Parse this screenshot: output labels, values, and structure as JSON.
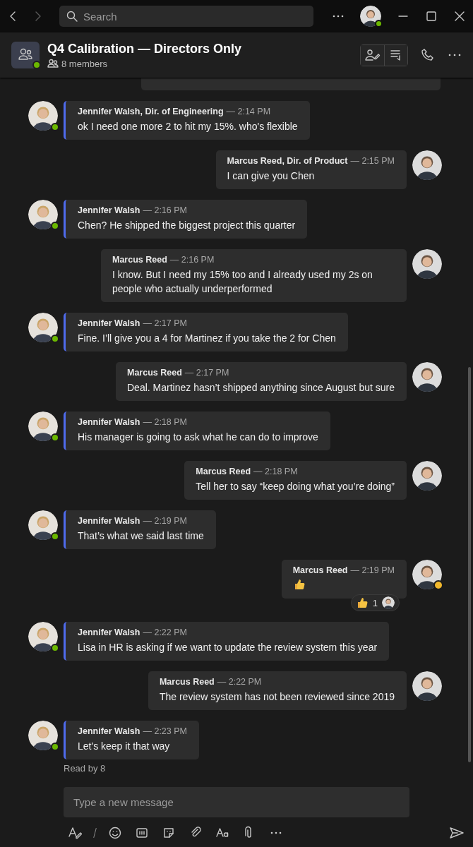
{
  "title_bar": {
    "nav": [
      {
        "kind": "back",
        "disabled": false
      },
      {
        "kind": "forward",
        "disabled": true
      }
    ],
    "search": {
      "placeholder": "Search"
    },
    "online": true
  },
  "chat_header": {
    "title": "Q4 Calibration — Directors Only",
    "members": "8 members",
    "online": true
  },
  "messages": [
    {
      "kind": "sent",
      "cut_off": true
    },
    {
      "kind": "received",
      "sender": "Jennifer Walsh, Dir. of Engineering",
      "time": "— 2:14 PM",
      "text": "ok I need one more 2 to hit my 15%. who's flexible",
      "online": true
    },
    {
      "kind": "sent",
      "sender": "Marcus Reed, Dir. of Product",
      "time": "— 2:15 PM",
      "text": "I can give you Chen"
    },
    {
      "kind": "received",
      "sender": "Jennifer Walsh",
      "time": "— 2:16 PM",
      "text": "Chen? He shipped the biggest project this quarter",
      "online": true
    },
    {
      "kind": "sent",
      "sender": "Marcus Reed",
      "time": "— 2:16 PM",
      "text": "I know. But I need my 15% too and I already used my 2s on people who actually underperformed"
    },
    {
      "kind": "received",
      "sender": "Jennifer Walsh",
      "time": "— 2:17 PM",
      "text": "Fine. I’ll give you a 4 for Martinez if you take the 2 for Chen",
      "online": true
    },
    {
      "kind": "sent",
      "sender": "Marcus Reed",
      "time": "— 2:17 PM",
      "text": "Deal. Martinez hasn’t shipped anything since August but sure"
    },
    {
      "kind": "received",
      "sender": "Jennifer Walsh",
      "time": "— 2:18 PM",
      "text": "His manager is going to ask what he can do to improve",
      "online": true
    },
    {
      "kind": "sent",
      "sender": "Marcus Reed",
      "time": "— 2:18 PM",
      "text": "Tell her to say “keep doing what you’re doing”"
    },
    {
      "kind": "received",
      "sender": "Jennifer Walsh",
      "time": "— 2:19 PM",
      "text": "That’s what we said last time",
      "online": true
    },
    {
      "kind": "sent",
      "sender": "Marcus Reed",
      "time": "— 2:19 PM",
      "thumbs_up": true,
      "emoji_status": true,
      "reaction": {
        "count": "1"
      }
    },
    {
      "kind": "received",
      "sender": "Jennifer Walsh",
      "time": "— 2:22 PM",
      "text": "Lisa in HR is asking if we want to update the review system this year",
      "online": true
    },
    {
      "kind": "sent",
      "sender": "Marcus Reed",
      "time": "— 2:22 PM",
      "text": "The review system has not been reviewed since 2019"
    },
    {
      "kind": "received",
      "sender": "Jennifer Walsh",
      "time": "— 2:23 PM",
      "text": "Let's keep it that way",
      "online": true
    }
  ],
  "read_receipt": "Read by 8",
  "composer": {
    "placeholder": "Type a new message"
  }
}
